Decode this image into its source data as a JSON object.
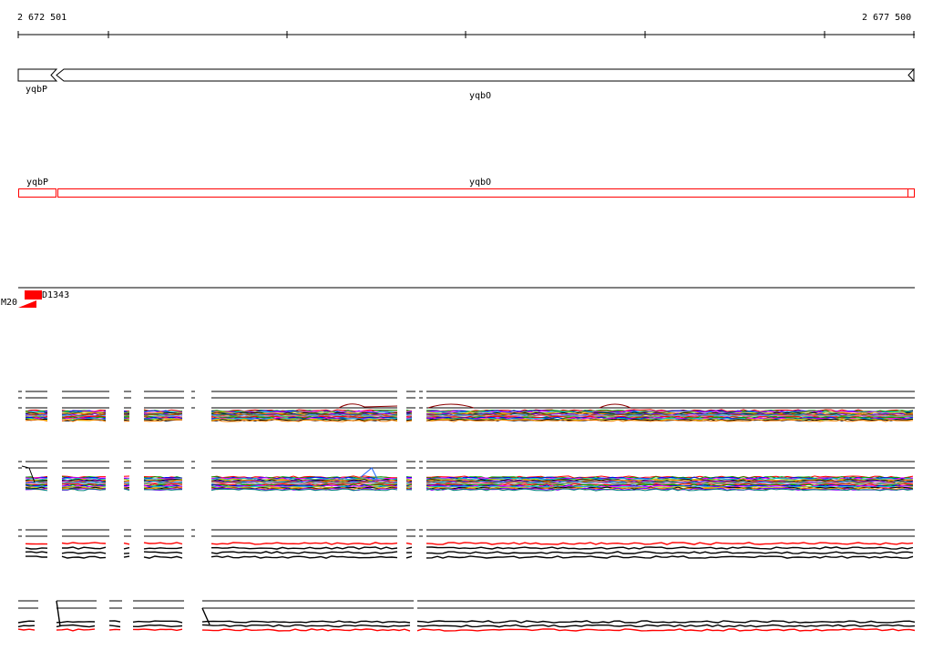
{
  "coordinates": {
    "start": "2 672 501",
    "end": "2 677 500"
  },
  "genes": [
    {
      "name": "yqbP",
      "strand": "reverse"
    },
    {
      "name": "yqbO",
      "strand": "reverse"
    }
  ],
  "transcripts": [
    {
      "name": "yqbP"
    },
    {
      "name": "yqbO"
    }
  ],
  "features": [
    {
      "name": "M20"
    },
    {
      "name": "D1343"
    }
  ],
  "colors": {
    "gene_outline": "#000000",
    "transcript_outline": "#ff0000",
    "feature_fill": "#ff0000",
    "expression_highlight": "#ff0000"
  }
}
